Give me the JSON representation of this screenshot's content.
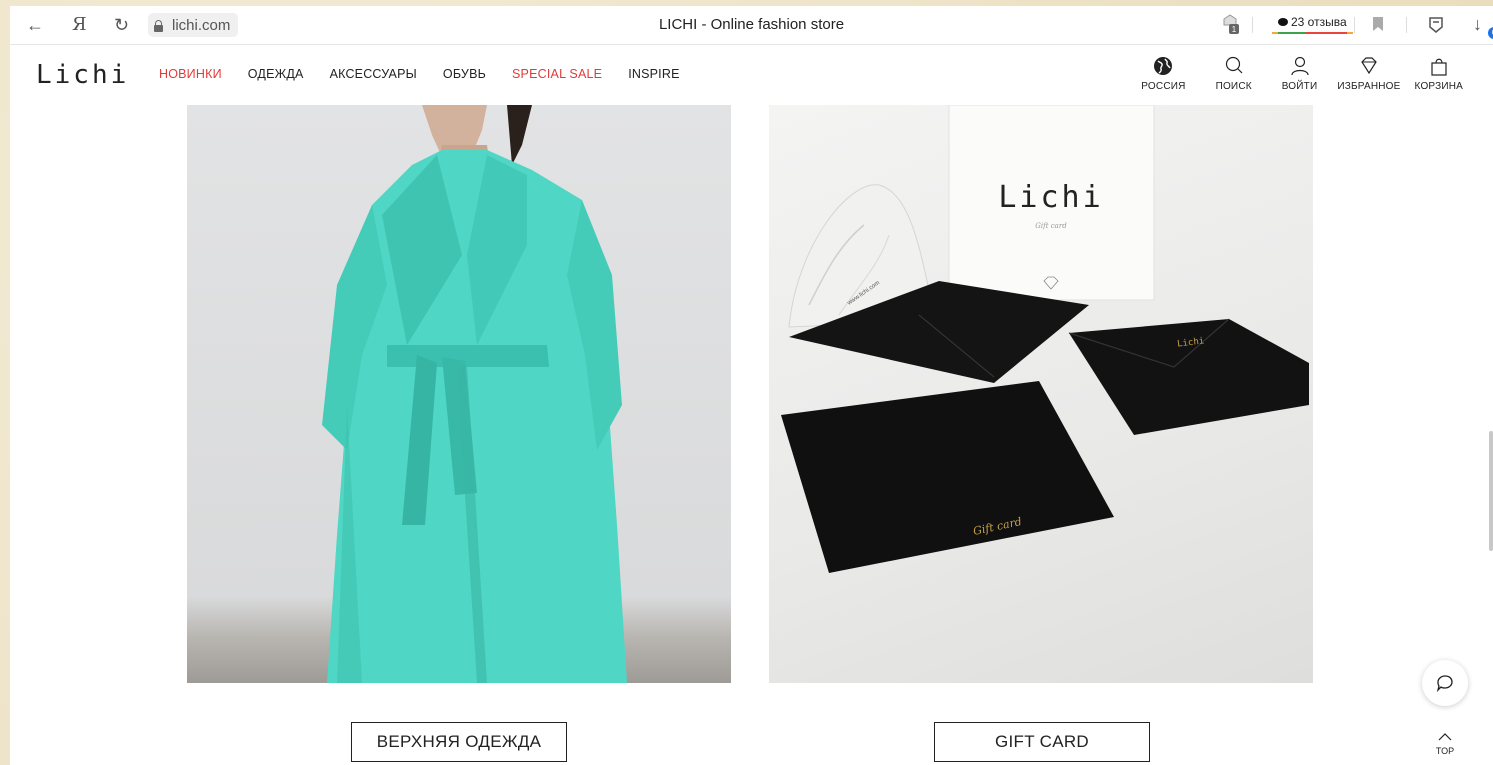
{
  "browser": {
    "url": "lichi.com",
    "tab_title": "LICHI - Online fashion store",
    "reviews_label": "23 отзыва",
    "yandex_label": "Я",
    "downloads_count": "6",
    "puzzle_badge": "1"
  },
  "header": {
    "logo": "Lichi",
    "nav": [
      {
        "label": "НОВИНКИ",
        "accent": true
      },
      {
        "label": "ОДЕЖДА",
        "accent": false
      },
      {
        "label": "АКСЕССУАРЫ",
        "accent": false
      },
      {
        "label": "ОБУВЬ",
        "accent": false
      },
      {
        "label": "SPECIAL SALE",
        "accent": true
      },
      {
        "label": "INSPIRE",
        "accent": false
      }
    ],
    "actions": [
      {
        "label": "РОССИЯ",
        "icon": "globe-icon"
      },
      {
        "label": "ПОИСК",
        "icon": "search-icon"
      },
      {
        "label": "ВОЙТИ",
        "icon": "user-icon"
      },
      {
        "label": "ИЗБРАННОЕ",
        "icon": "diamond-icon"
      },
      {
        "label": "КОРЗИНА",
        "icon": "bag-icon"
      }
    ]
  },
  "categories": [
    {
      "label": "ВЕРХНЯЯ ОДЕЖДА",
      "image": "turquoise-wrap-coat"
    },
    {
      "label": "GIFT CARD",
      "image": "gift-card-envelopes"
    }
  ],
  "gift_card": {
    "card_logo": "Lichi",
    "card_subtitle": "Gift card",
    "envelope_logo": "Lichi",
    "envelope_text": "Gift card",
    "website": "www.lichi.com"
  },
  "floating": {
    "top_label": "TOP"
  },
  "colors": {
    "accent_red": "#e23a3a",
    "coat_turquoise": "#4fd6c4"
  }
}
